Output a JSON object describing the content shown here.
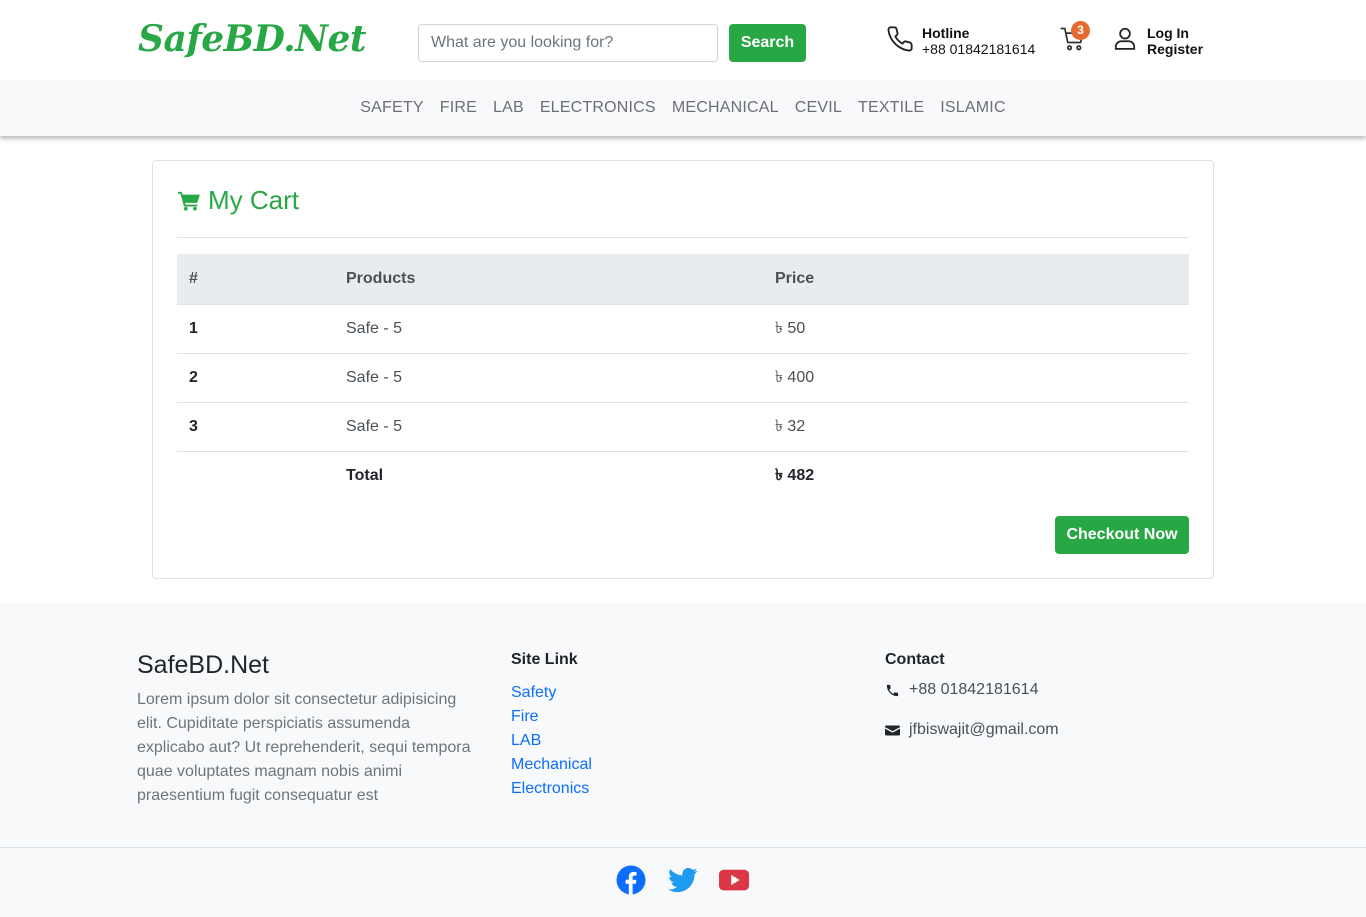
{
  "header": {
    "logo": "SafeBD.Net",
    "search_placeholder": "What are you looking for?",
    "search_button": "Search",
    "hotline_label": "Hotline",
    "hotline_number": "+88 01842181614",
    "cart_count": "3",
    "login": "Log In",
    "register": "Register"
  },
  "nav": [
    "SAFETY",
    "FIRE",
    "LAB",
    "ELECTRONICS",
    "MECHANICAL",
    "CEVIL",
    "TEXTILE",
    "ISLAMIC"
  ],
  "cart": {
    "title": "My Cart",
    "columns": [
      "#",
      "Products",
      "Price"
    ],
    "rows": [
      {
        "num": "1",
        "product": "Safe - 5",
        "price": "৳ 50"
      },
      {
        "num": "2",
        "product": "Safe - 5",
        "price": "৳ 400"
      },
      {
        "num": "3",
        "product": "Safe - 5",
        "price": "৳ 32"
      }
    ],
    "total_label": "Total",
    "total_value": "৳ 482",
    "checkout_button": "Checkout Now"
  },
  "footer": {
    "brand": "SafeBD.Net",
    "about": "Lorem ipsum dolor sit consectetur adipisicing elit. Cupiditate perspiciatis assumenda explicabo aut? Ut reprehenderit, sequi tempora quae voluptates magnam nobis animi praesentium fugit consequatur est",
    "site_link_heading": "Site Link",
    "site_links": [
      "Safety",
      "Fire",
      "LAB",
      "Mechanical",
      "Electronics"
    ],
    "contact_heading": "Contact",
    "phone": "+88 01842181614",
    "email": "jfbiswajit@gmail.com"
  },
  "colors": {
    "brand_green": "#28a745",
    "link_blue": "#0d6efd",
    "badge_orange": "#e8692f",
    "facebook": "#0d6efd",
    "twitter": "#1d9bf0",
    "youtube": "#dc3545"
  },
  "icons": [
    "phone-icon",
    "cart-icon",
    "user-icon",
    "shopping-cart-icon",
    "envelope-icon",
    "facebook-icon",
    "twitter-icon",
    "youtube-icon"
  ]
}
